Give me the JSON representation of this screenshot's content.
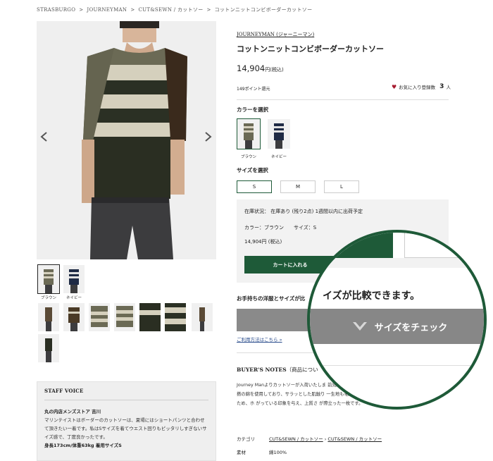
{
  "breadcrumb": [
    "STRASBURGO",
    "JOURNEYMAN",
    "CUT&SEWN / カットソー",
    "コットンニットコンビボーダーカットソー"
  ],
  "gallery": {
    "thumb_captions": [
      "ブラウン",
      "ネイビー"
    ]
  },
  "staff_voice": {
    "heading": "STAFF VOICE",
    "store": "丸の内店メンズストア 吉川",
    "body": "マリンテイストはボーダーのカットソーは、夏場にはショートパンツと合わせて頂きたい一着です。私はSサイズを着てウエスト回りもピッタリしすぎないサイズ感で、丁度良かったです。",
    "size": "身長173cm/体重63kg 着用サイズS"
  },
  "product": {
    "brand": "JOURNEYMAN (ジャーニーマン)",
    "title": "コットンニットコンビボーダーカットソー",
    "price": "14,904",
    "price_suffix": "円(税込)",
    "points": "149ポイント還元",
    "fav_label": "お気に入り登録数",
    "fav_count": "3",
    "fav_unit": "人"
  },
  "color_select": {
    "label": "カラーを選択",
    "options": [
      "ブラウン",
      "ネイビー"
    ]
  },
  "size_select": {
    "label": "サイズを選択",
    "options": [
      "S",
      "M",
      "L"
    ]
  },
  "stock": {
    "status": "在庫状況： 在庫あり (残り2点) 1週間以内に出荷予定",
    "color": "カラー：ブラウン",
    "size": "サイズ：S",
    "subtotal": "14,904円 (税込)",
    "cart_button": "カートに入れる"
  },
  "compare": {
    "heading": "お手持ちの洋服とサイズが比",
    "howto": "ご利用方法はこちら »",
    "lens_text": "イズが比較できます。",
    "lens_button": "サイズをチェック"
  },
  "notes": {
    "title": "BUYER'S NOTES",
    "title_suffix": "（商品につい",
    "body": "Journey Manよりカットソーが入荷いたしま 前見頃と衿ぐりはニットで、袖、後ろ見頃はカ ト部分は撲撚の綿を使用しており、サラッとした肌触り 一生地も毛羽の少ないやや光沢を帯びた素材を使用しているため、ホ がっている印象を与え、上質さ が際立った一枚です。"
  },
  "spec": {
    "category_label": "カテゴリ",
    "category_link1": "CUT&SEWN / カットソー",
    "category_sep": " › ",
    "category_link2": "CUT&SEWN / カットソー",
    "material_label": "素材",
    "material_value": "綿100%"
  }
}
